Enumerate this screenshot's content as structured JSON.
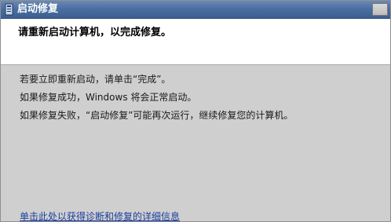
{
  "window": {
    "title": "启动修复",
    "icon": "startup-repair-icon"
  },
  "header": {
    "text": "请重新启动计算机，以完成修复。"
  },
  "messages": [
    "若要立即重新启动，请单击“完成”。",
    "如果修复成功，Windows 将会正常启动。",
    "如果修复失败，“启动修复”可能再次运行，继续修复您的计算机。"
  ],
  "details_link": "单击此处以获得诊断和修复的详细信息",
  "colors": {
    "titlebar": "#4a6fa2",
    "link": "#1b3fa0"
  }
}
